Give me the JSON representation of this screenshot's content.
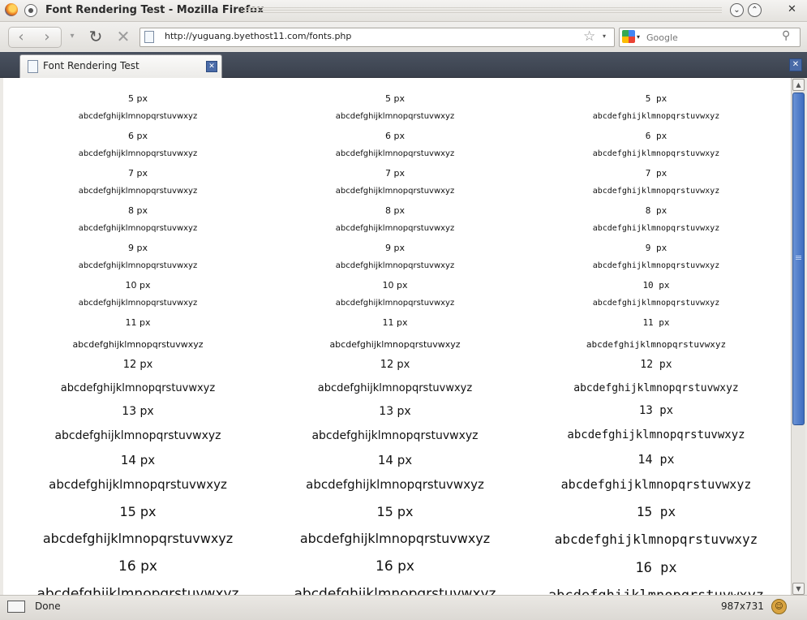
{
  "window": {
    "title": "Font Rendering Test - Mozilla Firefox",
    "menu_icon": "window-menu-icon",
    "minimize_glyph": "⌄",
    "maximize_glyph": "⌃",
    "close_glyph": "✕"
  },
  "toolbar": {
    "back_glyph": "‹",
    "forward_glyph": "›",
    "history_glyph": "▾",
    "reload_glyph": "↻",
    "stop_glyph": "✕",
    "url": "http://yuguang.byethost11.com/fonts.php",
    "bookmark_glyph": "☆",
    "dropdown_glyph": "▾",
    "search_placeholder": "Google",
    "search_engine_dropdown_glyph": "▾",
    "search_glyph": "⚲"
  },
  "tabs": [
    {
      "label": "Font Rendering Test",
      "close_glyph": "✕",
      "active": true
    }
  ],
  "tab_list_close_glyph": "✕",
  "content": {
    "columns": [
      {
        "rows": [
          "5 px",
          "abcdefghijklmnopqrstuvwxyz",
          "6 px",
          "abcdefghijklmnopqrstuvwxyz",
          "7 px",
          "abcdefghijklmnopqrstuvwxyz",
          "8 px",
          "abcdefghijklmnopqrstuvwxyz",
          "9 px",
          "abcdefghijklmnopqrstuvwxyz",
          "10 px",
          "abcdefghijklmnopqrstuvwxyz",
          "11 px",
          "abcdefghijklmnopqrstuvwxyz",
          "12 px",
          "abcdefghijklmnopqrstuvwxyz",
          "13 px",
          "abcdefghijklmnopqrstuvwxyz",
          "14 px",
          "abcdefghijklmnopqrstuvwxyz",
          "15 px",
          "abcdefghijklmnopqrstuvwxyz",
          "16 px",
          "abcdefghijklmnopqrstuvwxyz"
        ]
      },
      {
        "rows": [
          "5 px",
          "abcdefghijklmnopqrstuvwxyz",
          "6 px",
          "abcdefghijklmnopqrstuvwxyz",
          "7 px",
          "abcdefghijklmnopqrstuvwxyz",
          "8 px",
          "abcdefghijklmnopqrstuvwxyz",
          "9 px",
          "abcdefghijklmnopqrstuvwxyz",
          "10 px",
          "abcdefghijklmnopqrstuvwxyz",
          "11 px",
          "abcdefghijklmnopqrstuvwxyz",
          "12 px",
          "abcdefghijklmnopqrstuvwxyz",
          "13 px",
          "abcdefghijklmnopqrstuvwxyz",
          "14 px",
          "abcdefghijklmnopqrstuvwxyz",
          "15 px",
          "abcdefghijklmnopqrstuvwxyz",
          "16 px",
          "abcdefghijklmnopqrstuvwxyz"
        ]
      },
      {
        "rows": [
          "5 px",
          "abcdefghijklmnopqrstuvwxyz",
          "6 px",
          "abcdefghijklmnopqrstuvwxyz",
          "7 px",
          "abcdefghijklmnopqrstuvwxyz",
          "8 px",
          "abcdefghijklmnopqrstuvwxyz",
          "9 px",
          "abcdefghijklmnopqrstuvwxyz",
          "10 px",
          "abcdefghijklmnopqrstuvwxyz",
          "11 px",
          "abcdefghijklmnopqrstuvwxyz",
          "12 px",
          "abcdefghijklmnopqrstuvwxyz",
          "13 px",
          "abcdefghijklmnopqrstuvwxyz",
          "14 px",
          "abcdefghijklmnopqrstuvwxyz",
          "15 px",
          "abcdefghijklmnopqrstuvwxyz",
          "16 px",
          "abcdefghijklmnopqrstuvwxyz"
        ]
      }
    ]
  },
  "scrollbar": {
    "up_glyph": "▲",
    "down_glyph": "▼",
    "position": 0.0
  },
  "statusbar": {
    "status": "Done",
    "window_size": "987x731",
    "addon_glyph": "☺"
  }
}
